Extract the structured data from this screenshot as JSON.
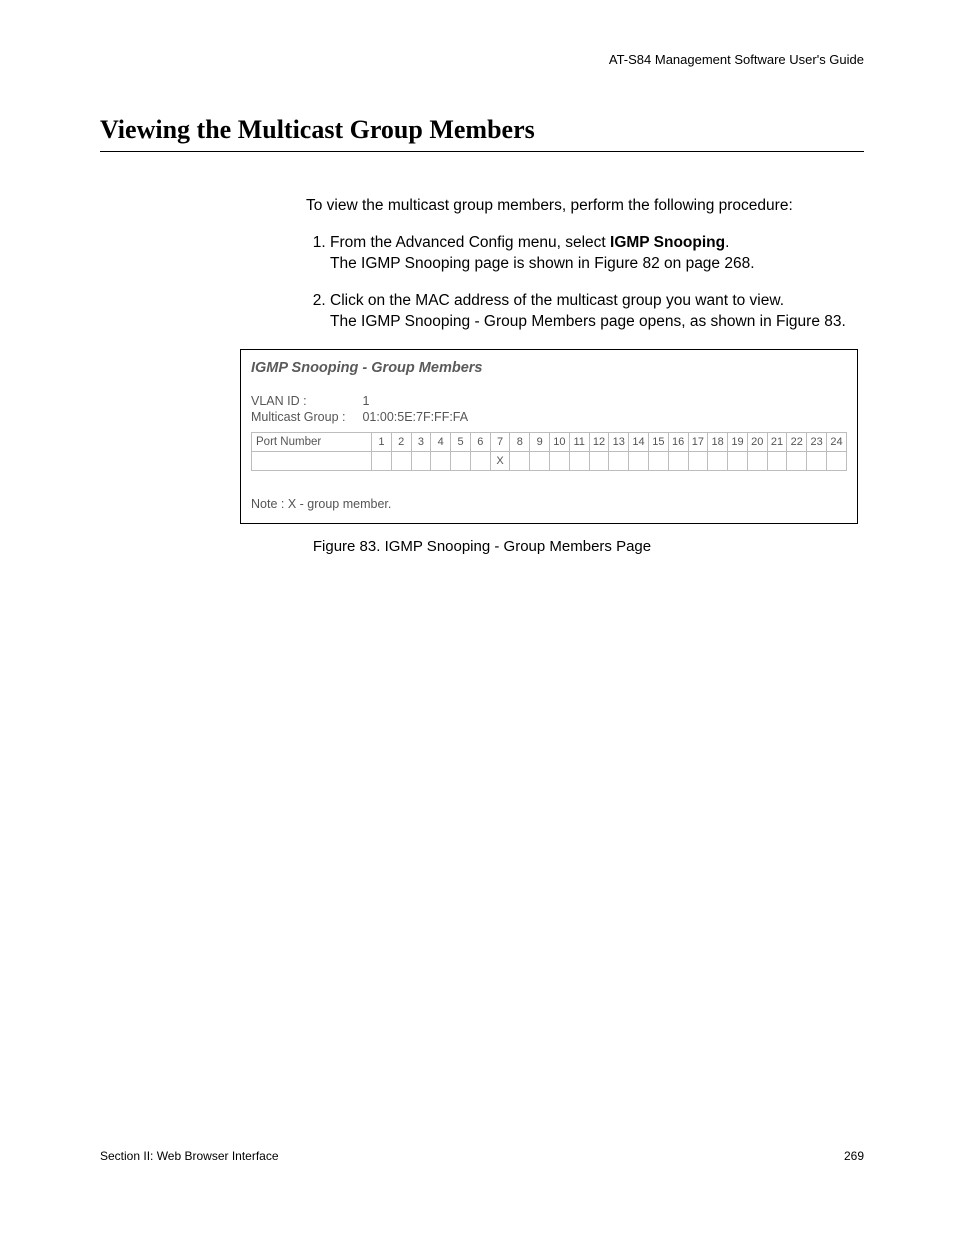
{
  "header": {
    "running_title": "AT-S84 Management Software User's Guide"
  },
  "heading": "Viewing the Multicast Group Members",
  "intro": "To view the multicast group members, perform the following procedure:",
  "steps": [
    {
      "text_pre": "From the Advanced Config menu, select ",
      "text_strong": "IGMP Snooping",
      "text_post": ".",
      "sub": "The IGMP Snooping page is shown in Figure 82 on page 268."
    },
    {
      "text_pre": "Click on the MAC address of the multicast group you want to view.",
      "text_strong": "",
      "text_post": "",
      "sub": "The IGMP Snooping - Group Members page opens, as shown in Figure 83."
    }
  ],
  "figure": {
    "title": "IGMP Snooping - Group Members",
    "vlan_label": "VLAN ID :",
    "vlan_value": "1",
    "group_label": "Multicast Group :",
    "group_value": "01:00:5E:7F:FF:FA",
    "port_label": "Port Number",
    "port_columns": [
      "1",
      "2",
      "3",
      "4",
      "5",
      "6",
      "7",
      "8",
      "9",
      "10",
      "11",
      "12",
      "13",
      "14",
      "15",
      "16",
      "17",
      "18",
      "19",
      "20",
      "21",
      "22",
      "23",
      "24"
    ],
    "port_members": [
      "",
      "",
      "",
      "",
      "",
      "",
      "X",
      "",
      "",
      "",
      "",
      "",
      "",
      "",
      "",
      "",
      "",
      "",
      "",
      "",
      "",
      "",
      "",
      ""
    ],
    "note": "Note : X - group member."
  },
  "caption": "Figure 83. IGMP Snooping - Group Members Page",
  "footer": {
    "left": "Section II: Web Browser Interface",
    "right": "269"
  }
}
